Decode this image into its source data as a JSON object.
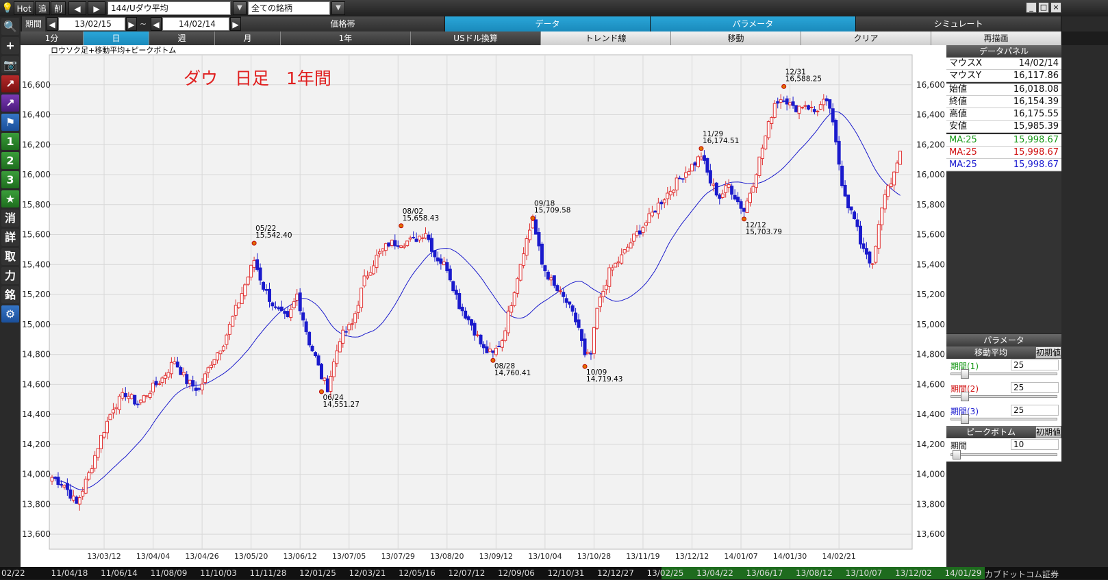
{
  "toolbar": {
    "hot": "Hot",
    "add": "追",
    "del": "削",
    "symbol": "144/Uダウ平均",
    "universe": "全ての銘柄",
    "period_label": "期間",
    "date_from": "13/02/15",
    "tilde": "~",
    "date_to": "14/02/14"
  },
  "top_tabs": [
    "価格帯",
    "データ",
    "パラメータ",
    "シミュレート"
  ],
  "period_tabs": [
    "1分",
    "日",
    "週",
    "月",
    "1年"
  ],
  "action_tabs": [
    "USドル換算",
    "トレンド線",
    "移動",
    "クリア",
    "再描画"
  ],
  "left_tools": [
    {
      "icon": "zoom-icon",
      "glyph": "🔍"
    },
    {
      "icon": "crosshair-icon",
      "glyph": "+"
    },
    {
      "icon": "camera-icon",
      "glyph": "📷"
    },
    {
      "icon": "chart-red-icon",
      "glyph": "↗"
    },
    {
      "icon": "chart-purple-icon",
      "glyph": "↗"
    },
    {
      "icon": "flag-icon",
      "glyph": "⚑"
    },
    {
      "icon": "one-icon",
      "glyph": "1"
    },
    {
      "icon": "two-icon",
      "glyph": "2"
    },
    {
      "icon": "three-icon",
      "glyph": "3"
    },
    {
      "icon": "star-icon",
      "glyph": "★"
    },
    {
      "icon": "erase-icon",
      "glyph": "消"
    },
    {
      "icon": "detail-icon",
      "glyph": "詳"
    },
    {
      "icon": "take-icon",
      "glyph": "取"
    },
    {
      "icon": "power-icon",
      "glyph": "力"
    },
    {
      "icon": "symbol-icon",
      "glyph": "銘"
    },
    {
      "icon": "gear-icon",
      "glyph": "⚙"
    }
  ],
  "chart_caption": "ロウソク足+移動平均+ピークボトム",
  "chart_annotation": "ダウ　日足　1年間",
  "data_panel": {
    "title": "データパネル",
    "rows": [
      {
        "k": "マウスX",
        "v": "14/02/14"
      },
      {
        "k": "マウスY",
        "v": "16,117.86"
      },
      {
        "k": "始値",
        "v": "16,018.08"
      },
      {
        "k": "終値",
        "v": "16,154.39"
      },
      {
        "k": "高値",
        "v": "16,175.55"
      },
      {
        "k": "安値",
        "v": "15,985.39"
      }
    ],
    "ma_rows": [
      {
        "k": "MA:25",
        "v": "15,998.67",
        "color": "#1a9a1a"
      },
      {
        "k": "MA:25",
        "v": "15,998.67",
        "color": "#d01010"
      },
      {
        "k": "MA:25",
        "v": "15,998.67",
        "color": "#1a1ad0"
      }
    ]
  },
  "param_panel": {
    "title": "パラメータ",
    "ma_title": "移動平均",
    "reset": "初期値",
    "periods": [
      {
        "label": "期間(1)",
        "value": "25",
        "color": "#1a9a1a"
      },
      {
        "label": "期間(2)",
        "value": "25",
        "color": "#d01010"
      },
      {
        "label": "期間(3)",
        "value": "25",
        "color": "#1a1ad0"
      }
    ],
    "pb_title": "ピークボトム",
    "pb_period_label": "期間",
    "pb_value": "10"
  },
  "bottom_bar": {
    "dates": [
      "02/22",
      "11/04/18",
      "11/06/14",
      "11/08/09",
      "11/10/03",
      "11/11/28",
      "12/01/25",
      "12/03/21",
      "12/05/16",
      "12/07/12",
      "12/09/06",
      "12/10/31",
      "12/12/27",
      "13/02/25",
      "13/04/22",
      "13/06/17",
      "13/08/12",
      "13/10/07",
      "13/12/02",
      "14/01/29"
    ],
    "brand": "カブドットコム証券"
  },
  "chart_data": {
    "type": "candlestick",
    "title": "ロウソク足+移動平均+ピークボトム",
    "ylim": [
      13500,
      16800
    ],
    "y_ticks": [
      13600,
      13800,
      14000,
      14200,
      14400,
      14600,
      14800,
      15000,
      15200,
      15400,
      15600,
      15800,
      16000,
      16200,
      16400,
      16600
    ],
    "y_tick_labels": [
      "13,600",
      "13,800",
      "14,000",
      "14,200",
      "14,400",
      "14,600",
      "14,800",
      "15,000",
      "15,200",
      "15,400",
      "15,600",
      "15,800",
      "16,000",
      "16,200",
      "16,400",
      "16,600"
    ],
    "x_ticks": [
      "13/03/12",
      "13/04/04",
      "13/04/26",
      "13/05/20",
      "13/06/12",
      "13/07/05",
      "13/07/29",
      "13/08/20",
      "13/09/12",
      "13/10/04",
      "13/10/28",
      "13/11/19",
      "13/12/12",
      "14/01/07",
      "14/01/30",
      "14/02/21"
    ],
    "x_tick_index": [
      17,
      33,
      49,
      65,
      81,
      97,
      113,
      129,
      145,
      161,
      177,
      193,
      209,
      225,
      241,
      257
    ],
    "n_days": 251,
    "anchors": [
      [
        0,
        13980
      ],
      [
        4,
        13930
      ],
      [
        8,
        13800
      ],
      [
        12,
        14000
      ],
      [
        16,
        14250
      ],
      [
        20,
        14450
      ],
      [
        24,
        14540
      ],
      [
        28,
        14470
      ],
      [
        32,
        14560
      ],
      [
        36,
        14640
      ],
      [
        40,
        14760
      ],
      [
        44,
        14620
      ],
      [
        48,
        14560
      ],
      [
        52,
        14750
      ],
      [
        56,
        14880
      ],
      [
        60,
        15100
      ],
      [
        64,
        15320
      ],
      [
        66,
        15430
      ],
      [
        69,
        15250
      ],
      [
        73,
        15100
      ],
      [
        77,
        15030
      ],
      [
        80,
        15200
      ],
      [
        84,
        14880
      ],
      [
        86,
        14780
      ],
      [
        88,
        14650
      ],
      [
        90,
        14580
      ],
      [
        94,
        14910
      ],
      [
        98,
        15000
      ],
      [
        102,
        15300
      ],
      [
        106,
        15450
      ],
      [
        110,
        15540
      ],
      [
        114,
        15550
      ],
      [
        118,
        15560
      ],
      [
        122,
        15620
      ],
      [
        125,
        15460
      ],
      [
        129,
        15380
      ],
      [
        133,
        15130
      ],
      [
        137,
        15000
      ],
      [
        141,
        14830
      ],
      [
        144,
        14800
      ],
      [
        147,
        14900
      ],
      [
        150,
        15150
      ],
      [
        154,
        15500
      ],
      [
        157,
        15700
      ],
      [
        160,
        15400
      ],
      [
        164,
        15250
      ],
      [
        168,
        15150
      ],
      [
        172,
        14980
      ],
      [
        174,
        14780
      ],
      [
        176,
        14800
      ],
      [
        178,
        15100
      ],
      [
        182,
        15350
      ],
      [
        186,
        15450
      ],
      [
        190,
        15580
      ],
      [
        194,
        15680
      ],
      [
        198,
        15800
      ],
      [
        202,
        15900
      ],
      [
        206,
        16000
      ],
      [
        210,
        16080
      ],
      [
        212,
        16130
      ],
      [
        215,
        15950
      ],
      [
        218,
        15850
      ],
      [
        221,
        15930
      ],
      [
        224,
        15820
      ],
      [
        226,
        15760
      ],
      [
        229,
        15950
      ],
      [
        232,
        16180
      ],
      [
        236,
        16480
      ],
      [
        239,
        16520
      ],
      [
        242,
        16440
      ],
      [
        246,
        16470
      ],
      [
        249,
        16420
      ],
      [
        252,
        16480
      ],
      [
        254,
        16450
      ],
      [
        256,
        16200
      ],
      [
        258,
        15950
      ],
      [
        260,
        15800
      ],
      [
        262,
        15700
      ],
      [
        264,
        15550
      ],
      [
        266,
        15480
      ],
      [
        268,
        15380
      ],
      [
        270,
        15650
      ],
      [
        272,
        15880
      ],
      [
        274,
        15960
      ],
      [
        276,
        16050
      ],
      [
        277,
        16150
      ]
    ],
    "peaks": [
      {
        "idx": 66,
        "date": "05/22",
        "value": "15,542.40",
        "type": "peak"
      },
      {
        "idx": 88,
        "date": "06/24",
        "value": "14,551.27",
        "type": "bottom"
      },
      {
        "idx": 114,
        "date": "08/02",
        "value": "15,658.43",
        "type": "peak"
      },
      {
        "idx": 144,
        "date": "08/28",
        "value": "14,760.41",
        "type": "bottom"
      },
      {
        "idx": 157,
        "date": "09/18",
        "value": "15,709.58",
        "type": "peak"
      },
      {
        "idx": 174,
        "date": "10/09",
        "value": "14,719.43",
        "type": "bottom"
      },
      {
        "idx": 212,
        "date": "11/29",
        "value": "16,174.51",
        "type": "peak"
      },
      {
        "idx": 226,
        "date": "12/12",
        "value": "15,703.79",
        "type": "bottom"
      },
      {
        "idx": 239,
        "date": "12/31",
        "value": "16,588.25",
        "type": "peak"
      }
    ],
    "ma_period": 25,
    "up_color": "#e03030",
    "down_color": "#1a1acc",
    "ma_color": "#1a1acc"
  }
}
